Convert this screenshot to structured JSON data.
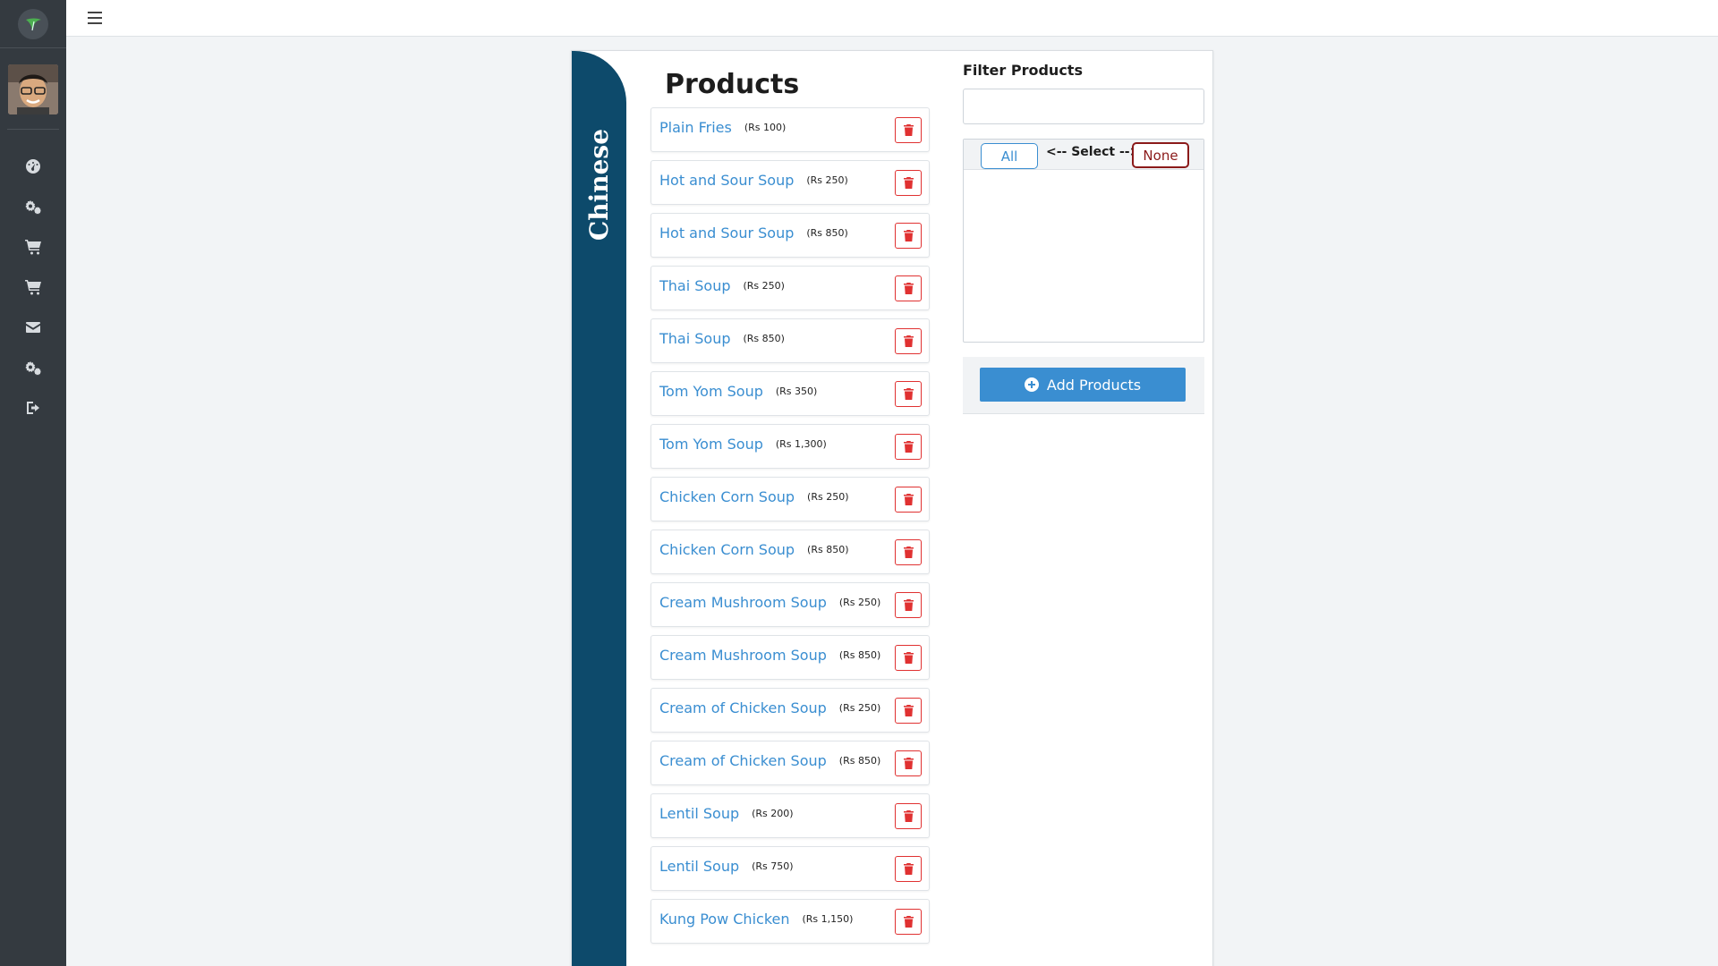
{
  "topbar": {
    "menu_icon": "hamburger-icon"
  },
  "sidebar": {
    "items": [
      {
        "icon": "dashboard-icon"
      },
      {
        "icon": "settings-icon"
      },
      {
        "icon": "cart-icon"
      },
      {
        "icon": "cart-icon"
      },
      {
        "icon": "envelope-icon"
      },
      {
        "icon": "settings-icon"
      },
      {
        "icon": "logout-icon"
      }
    ]
  },
  "category": {
    "tab_label": "Chinese"
  },
  "products": {
    "title": "Products",
    "items": [
      {
        "name": "Plain Fries",
        "price": "(Rs 100)"
      },
      {
        "name": "Hot and Sour Soup",
        "price": "(Rs 250)"
      },
      {
        "name": "Hot and Sour Soup",
        "price": "(Rs 850)"
      },
      {
        "name": "Thai Soup",
        "price": "(Rs 250)"
      },
      {
        "name": "Thai Soup",
        "price": "(Rs 850)"
      },
      {
        "name": "Tom Yom Soup",
        "price": "(Rs 350)"
      },
      {
        "name": "Tom Yom Soup",
        "price": "(Rs 1,300)"
      },
      {
        "name": "Chicken Corn Soup",
        "price": "(Rs 250)"
      },
      {
        "name": "Chicken Corn Soup",
        "price": "(Rs 850)"
      },
      {
        "name": "Cream Mushroom Soup",
        "price": "(Rs 250)"
      },
      {
        "name": "Cream Mushroom Soup",
        "price": "(Rs 850)"
      },
      {
        "name": "Cream of Chicken Soup",
        "price": "(Rs 250)"
      },
      {
        "name": "Cream of Chicken Soup",
        "price": "(Rs 850)"
      },
      {
        "name": "Lentil Soup",
        "price": "(Rs 200)"
      },
      {
        "name": "Lentil Soup",
        "price": "(Rs 750)"
      },
      {
        "name": "Kung Pow Chicken",
        "price": "(Rs 1,150)"
      }
    ]
  },
  "filter": {
    "title": "Filter Products",
    "search_value": "",
    "all_label": "All",
    "select_label": "<-- Select -->",
    "none_label": "None",
    "add_label": "Add Products"
  },
  "colors": {
    "sidebar": "#343a40",
    "tab": "#0d4a6b",
    "link": "#3a8ed1",
    "danger": "#e03131"
  }
}
